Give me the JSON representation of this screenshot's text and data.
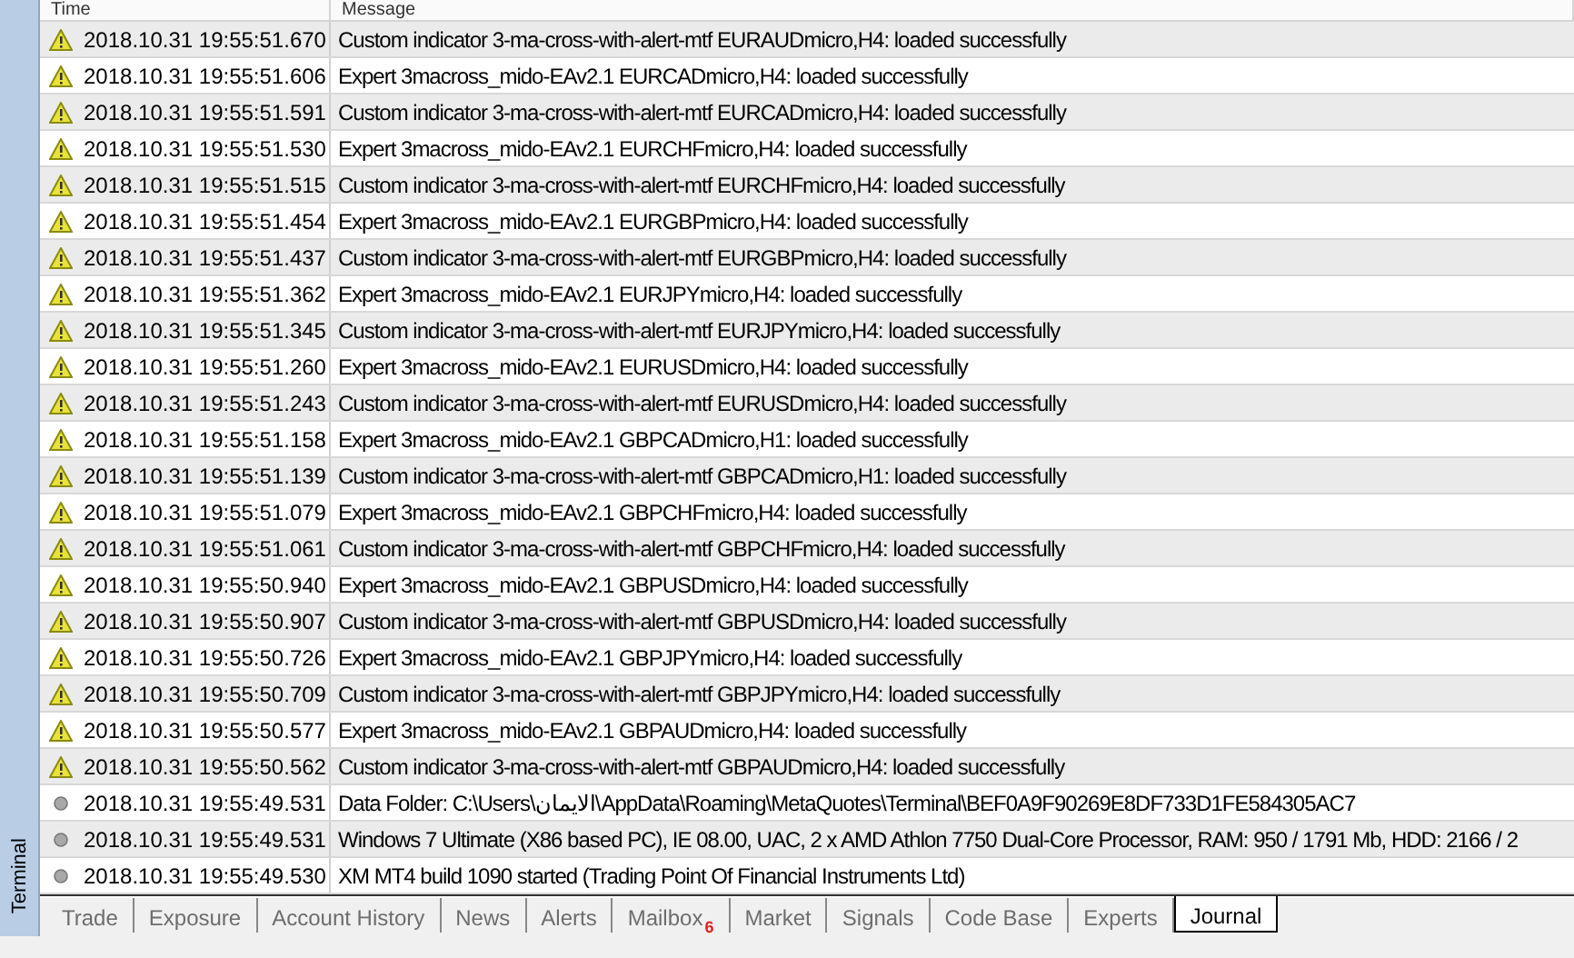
{
  "side_label": "Terminal",
  "columns": [
    "Time",
    "Message"
  ],
  "rows": [
    {
      "kind": "warning",
      "time": "2018.10.31 19:55:51.670",
      "message": "Custom indicator 3-ma-cross-with-alert-mtf EURAUDmicro,H4: loaded successfully"
    },
    {
      "kind": "warning",
      "time": "2018.10.31 19:55:51.606",
      "message": "Expert 3macross_mido-EAv2.1 EURCADmicro,H4: loaded successfully"
    },
    {
      "kind": "warning",
      "time": "2018.10.31 19:55:51.591",
      "message": "Custom indicator 3-ma-cross-with-alert-mtf EURCADmicro,H4: loaded successfully"
    },
    {
      "kind": "warning",
      "time": "2018.10.31 19:55:51.530",
      "message": "Expert 3macross_mido-EAv2.1 EURCHFmicro,H4: loaded successfully"
    },
    {
      "kind": "warning",
      "time": "2018.10.31 19:55:51.515",
      "message": "Custom indicator 3-ma-cross-with-alert-mtf EURCHFmicro,H4: loaded successfully"
    },
    {
      "kind": "warning",
      "time": "2018.10.31 19:55:51.454",
      "message": "Expert 3macross_mido-EAv2.1 EURGBPmicro,H4: loaded successfully"
    },
    {
      "kind": "warning",
      "time": "2018.10.31 19:55:51.437",
      "message": "Custom indicator 3-ma-cross-with-alert-mtf EURGBPmicro,H4: loaded successfully"
    },
    {
      "kind": "warning",
      "time": "2018.10.31 19:55:51.362",
      "message": "Expert 3macross_mido-EAv2.1 EURJPYmicro,H4: loaded successfully"
    },
    {
      "kind": "warning",
      "time": "2018.10.31 19:55:51.345",
      "message": "Custom indicator 3-ma-cross-with-alert-mtf EURJPYmicro,H4: loaded successfully"
    },
    {
      "kind": "warning",
      "time": "2018.10.31 19:55:51.260",
      "message": "Expert 3macross_mido-EAv2.1 EURUSDmicro,H4: loaded successfully"
    },
    {
      "kind": "warning",
      "time": "2018.10.31 19:55:51.243",
      "message": "Custom indicator 3-ma-cross-with-alert-mtf EURUSDmicro,H4: loaded successfully"
    },
    {
      "kind": "warning",
      "time": "2018.10.31 19:55:51.158",
      "message": "Expert 3macross_mido-EAv2.1 GBPCADmicro,H1: loaded successfully"
    },
    {
      "kind": "warning",
      "time": "2018.10.31 19:55:51.139",
      "message": "Custom indicator 3-ma-cross-with-alert-mtf GBPCADmicro,H1: loaded successfully"
    },
    {
      "kind": "warning",
      "time": "2018.10.31 19:55:51.079",
      "message": "Expert 3macross_mido-EAv2.1 GBPCHFmicro,H4: loaded successfully"
    },
    {
      "kind": "warning",
      "time": "2018.10.31 19:55:51.061",
      "message": "Custom indicator 3-ma-cross-with-alert-mtf GBPCHFmicro,H4: loaded successfully"
    },
    {
      "kind": "warning",
      "time": "2018.10.31 19:55:50.940",
      "message": "Expert 3macross_mido-EAv2.1 GBPUSDmicro,H4: loaded successfully"
    },
    {
      "kind": "warning",
      "time": "2018.10.31 19:55:50.907",
      "message": "Custom indicator 3-ma-cross-with-alert-mtf GBPUSDmicro,H4: loaded successfully"
    },
    {
      "kind": "warning",
      "time": "2018.10.31 19:55:50.726",
      "message": "Expert 3macross_mido-EAv2.1 GBPJPYmicro,H4: loaded successfully"
    },
    {
      "kind": "warning",
      "time": "2018.10.31 19:55:50.709",
      "message": "Custom indicator 3-ma-cross-with-alert-mtf GBPJPYmicro,H4: loaded successfully"
    },
    {
      "kind": "warning",
      "time": "2018.10.31 19:55:50.577",
      "message": "Expert 3macross_mido-EAv2.1 GBPAUDmicro,H4: loaded successfully"
    },
    {
      "kind": "warning",
      "time": "2018.10.31 19:55:50.562",
      "message": "Custom indicator 3-ma-cross-with-alert-mtf GBPAUDmicro,H4: loaded successfully"
    },
    {
      "kind": "info",
      "time": "2018.10.31 19:55:49.531",
      "message": "Data Folder: C:\\Users\\الايمان\\AppData\\Roaming\\MetaQuotes\\Terminal\\BEF0A9F90269E8DF733D1FE584305AC7"
    },
    {
      "kind": "info",
      "time": "2018.10.31 19:55:49.531",
      "message": "Windows 7 Ultimate (X86 based PC), IE 08.00, UAC, 2 x AMD Athlon 7750 Dual-Core Processor, RAM: 950 / 1791 Mb, HDD: 2166 / 2"
    },
    {
      "kind": "info",
      "time": "2018.10.31 19:55:49.530",
      "message": "XM MT4 build 1090 started (Trading Point Of Financial Instruments Ltd)"
    }
  ],
  "tabs": [
    {
      "label": "Trade",
      "selected": false
    },
    {
      "label": "Exposure",
      "selected": false
    },
    {
      "label": "Account History",
      "selected": false
    },
    {
      "label": "News",
      "selected": false
    },
    {
      "label": "Alerts",
      "selected": false
    },
    {
      "label": "Mailbox",
      "badge": "6",
      "selected": false
    },
    {
      "label": "Market",
      "selected": false
    },
    {
      "label": "Signals",
      "selected": false
    },
    {
      "label": "Code Base",
      "selected": false
    },
    {
      "label": "Experts",
      "selected": false
    },
    {
      "label": "Journal",
      "selected": true
    }
  ]
}
